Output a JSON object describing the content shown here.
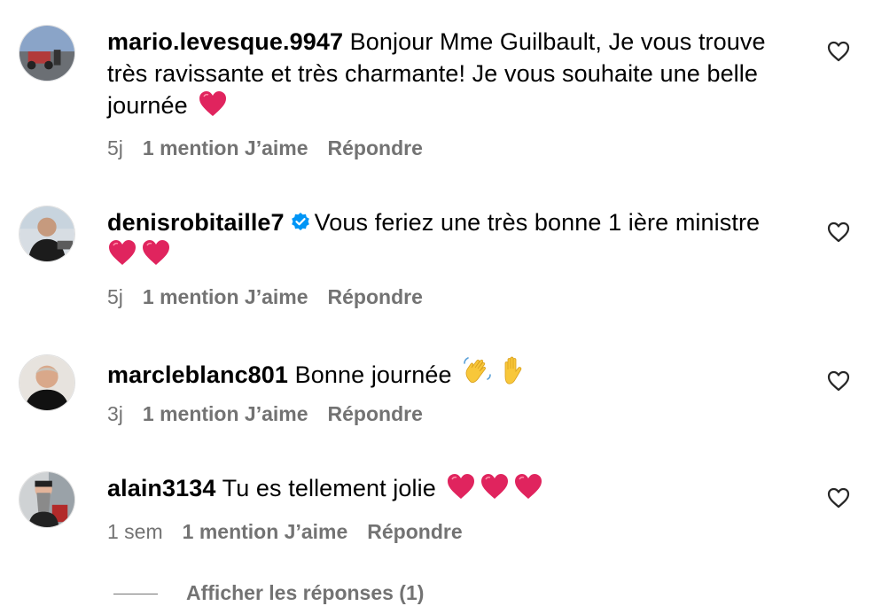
{
  "comments": [
    {
      "username": "mario.levesque.9947",
      "text": "Bonjour Mme Guilbault, Je vous trouve très ravissante et très charmante! Je vous souhaite une belle journée",
      "emojis": [
        "heart"
      ],
      "age": "5j",
      "likes": "1 mention J’aime",
      "reply": "Répondre",
      "verified": false
    },
    {
      "username": "denisrobitaille7",
      "text": "Vous feriez une très bonne 1 ière ministre",
      "emojis": [
        "heart",
        "heart"
      ],
      "age": "5j",
      "likes": "1 mention J’aime",
      "reply": "Répondre",
      "verified": true
    },
    {
      "username": "marcleblanc801",
      "text": "Bonne journée",
      "emojis": [
        "waving-hand",
        "raised-hand"
      ],
      "age": "3j",
      "likes": "1 mention J’aime",
      "reply": "Répondre",
      "verified": false
    },
    {
      "username": "alain3134",
      "text": "Tu es tellement jolie",
      "emojis": [
        "heart",
        "heart",
        "heart"
      ],
      "age": "1 sem",
      "likes": "1 mention J’aime",
      "reply": "Répondre",
      "verified": false
    }
  ],
  "view_replies": "Afficher les réponses (1)",
  "icons": {
    "like": "heart-outline-icon",
    "verified": "verified-badge-icon"
  },
  "colors": {
    "text": "#000000",
    "secondary": "#737373",
    "verified": "#0095f6",
    "heart_emoji": "#e0245e"
  }
}
